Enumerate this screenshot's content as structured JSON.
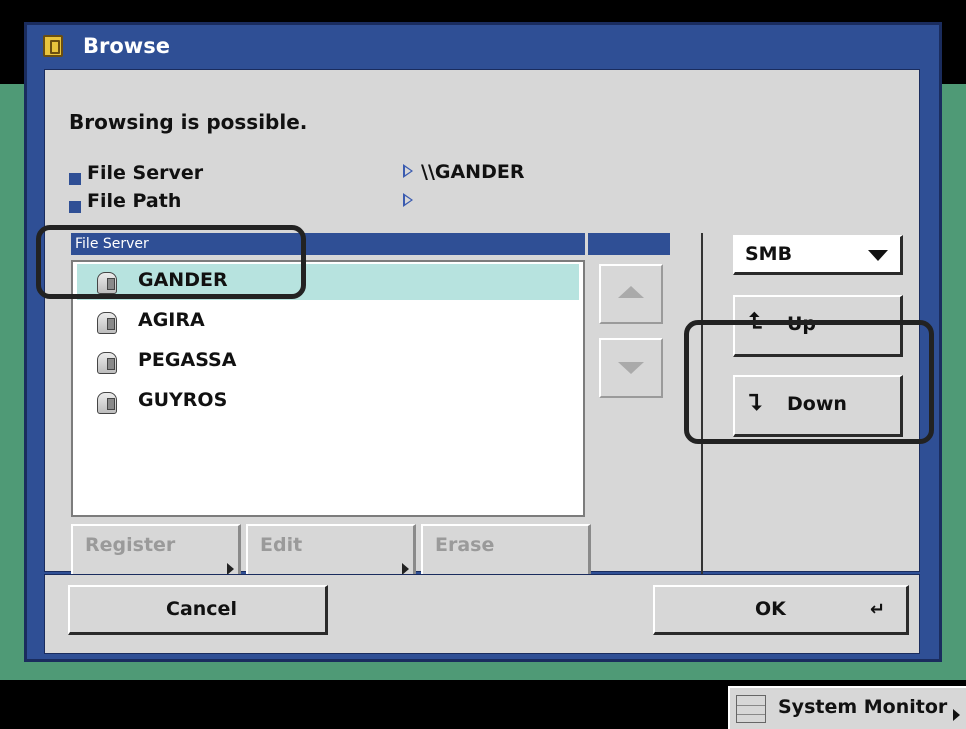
{
  "dialog": {
    "title": "Browse",
    "message": "Browsing is possible.",
    "file_server_label": "File Server",
    "file_server_value": "\\\\GANDER",
    "file_path_label": "File Path",
    "file_path_value": ""
  },
  "list": {
    "header": "File Server",
    "items": [
      {
        "label": "GANDER",
        "selected": true,
        "icon": "server-icon"
      },
      {
        "label": "AGIRA",
        "icon": "server-icon"
      },
      {
        "label": "PEGASSA",
        "icon": "server-icon"
      },
      {
        "label": "GUYROS",
        "icon": "server-icon"
      }
    ]
  },
  "buttons": {
    "register": "Register",
    "edit": "Edit",
    "erase": "Erase",
    "cancel": "Cancel",
    "ok": "OK",
    "up": "Up",
    "down": "Down"
  },
  "protocol": {
    "selected": "SMB"
  },
  "statusbar": {
    "system_monitor": "System Monitor"
  },
  "colors": {
    "dialog_blue": "#2f4f95",
    "panel_gray": "#d7d7d7",
    "selection": "#b7e3df",
    "background_green": "#4f9a76"
  }
}
